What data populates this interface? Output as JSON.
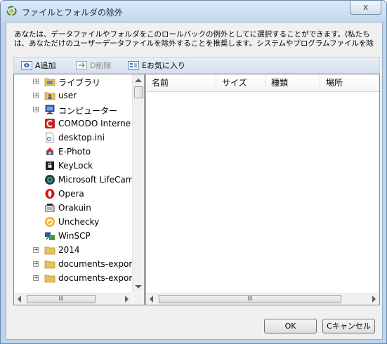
{
  "window": {
    "title": "ファイルとフォルダの除外",
    "close_label": "x"
  },
  "description": "あなたは、データファイルやフォルダをこのロールバックの例外としてに選択することができます。(私たちは、あなただけのユーザーデータファイルを除外することを推奨します。システムやプログラムファイルを除外すると破損する場合があります。)",
  "toolbar": {
    "add_label": "A追加",
    "delete_label": "D削除",
    "favorites_label": "Eお気に入り"
  },
  "tree": {
    "items": [
      {
        "label": "ライブラリ",
        "icon": "library-folder-icon",
        "expandable": true
      },
      {
        "label": "user",
        "icon": "user-folder-icon",
        "expandable": true
      },
      {
        "label": "コンピューター",
        "icon": "computer-icon",
        "expandable": true
      },
      {
        "label": "COMODO Interne",
        "icon": "comodo-icon",
        "expandable": false
      },
      {
        "label": "desktop.ini",
        "icon": "settings-file-icon",
        "expandable": false
      },
      {
        "label": "E-Photo",
        "icon": "ephoto-icon",
        "expandable": false
      },
      {
        "label": "KeyLock",
        "icon": "keylock-icon",
        "expandable": false
      },
      {
        "label": "Microsoft LifeCam",
        "icon": "lifecam-icon",
        "expandable": false
      },
      {
        "label": "Opera",
        "icon": "opera-icon",
        "expandable": false
      },
      {
        "label": "Orakuin",
        "icon": "orakuin-icon",
        "expandable": false
      },
      {
        "label": "Unchecky",
        "icon": "unchecky-icon",
        "expandable": false
      },
      {
        "label": "WinSCP",
        "icon": "winscp-icon",
        "expandable": false
      },
      {
        "label": "2014",
        "icon": "folder-icon",
        "expandable": true
      },
      {
        "label": "documents-expor",
        "icon": "folder-icon",
        "expandable": true
      },
      {
        "label": "documents-expor",
        "icon": "folder-icon",
        "expandable": true
      }
    ]
  },
  "list": {
    "columns": [
      "名前",
      "サイズ",
      "種類",
      "場所"
    ]
  },
  "buttons": {
    "ok_label": "OK",
    "cancel_label": "Cキャンセル"
  },
  "scrollbar_grip": "III"
}
